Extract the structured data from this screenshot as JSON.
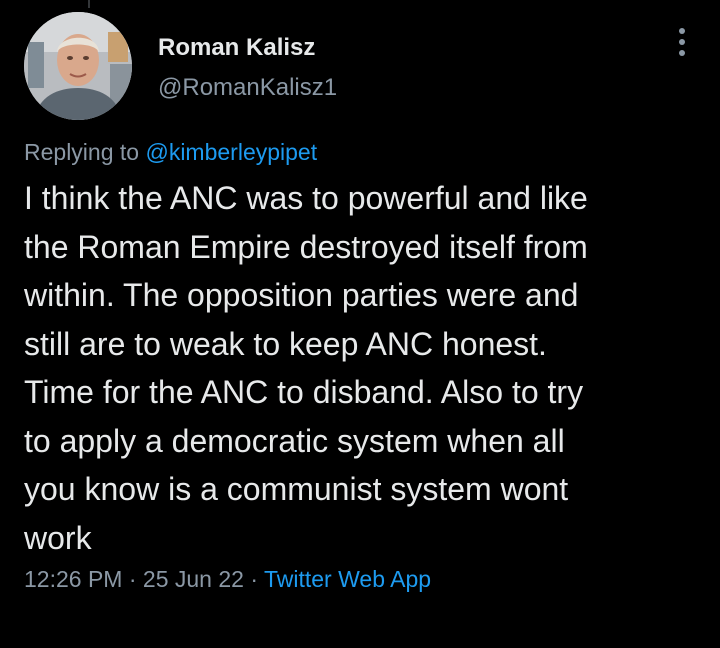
{
  "author": {
    "display_name": "Roman Kalisz",
    "handle": "@RomanKalisz1"
  },
  "reply": {
    "prefix": "Replying to",
    "mention": "@kimberleypipet"
  },
  "tweet": {
    "lines": [
      "I think the ANC was to powerful and like",
      "the Roman Empire destroyed itself from",
      "within. The opposition parties were and",
      "still are to weak to keep ANC honest.",
      "Time for the ANC to disband. Also to try",
      "to apply a democratic system when all",
      "you know is a communist system wont",
      "work"
    ]
  },
  "meta": {
    "time": "12:26 PM",
    "separator": "·",
    "date": "25 Jun 22",
    "source": "Twitter Web App"
  },
  "icons": {
    "more": "more-vertical-icon",
    "avatar": "profile-photo"
  },
  "colors": {
    "background": "#000000",
    "text_primary": "#e7e9ea",
    "text_secondary": "#8b98a5",
    "accent": "#1d9bf0"
  }
}
